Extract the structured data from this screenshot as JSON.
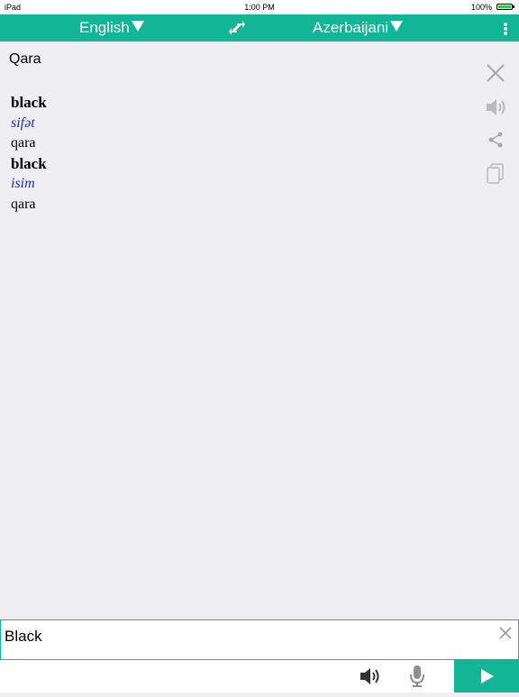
{
  "status_bar": {
    "carrier": "iPad",
    "time": "1:00 PM",
    "battery": "100%"
  },
  "header": {
    "source_language": "English",
    "target_language": "Azerbaijani",
    "accent_color": "#13b597"
  },
  "translation": {
    "source_text": "Qara",
    "entries": [
      {
        "word": "black",
        "part_of_speech": "sifət",
        "meaning": "qara"
      },
      {
        "word": "black",
        "part_of_speech": "isim",
        "meaning": "qara"
      }
    ]
  },
  "side_actions": [
    "close-icon",
    "speaker-icon",
    "share-icon",
    "copy-icon"
  ],
  "input": {
    "value": "Black"
  },
  "bottom_bar": {
    "icons": [
      "speaker-icon",
      "microphone-icon",
      "send-icon"
    ]
  }
}
